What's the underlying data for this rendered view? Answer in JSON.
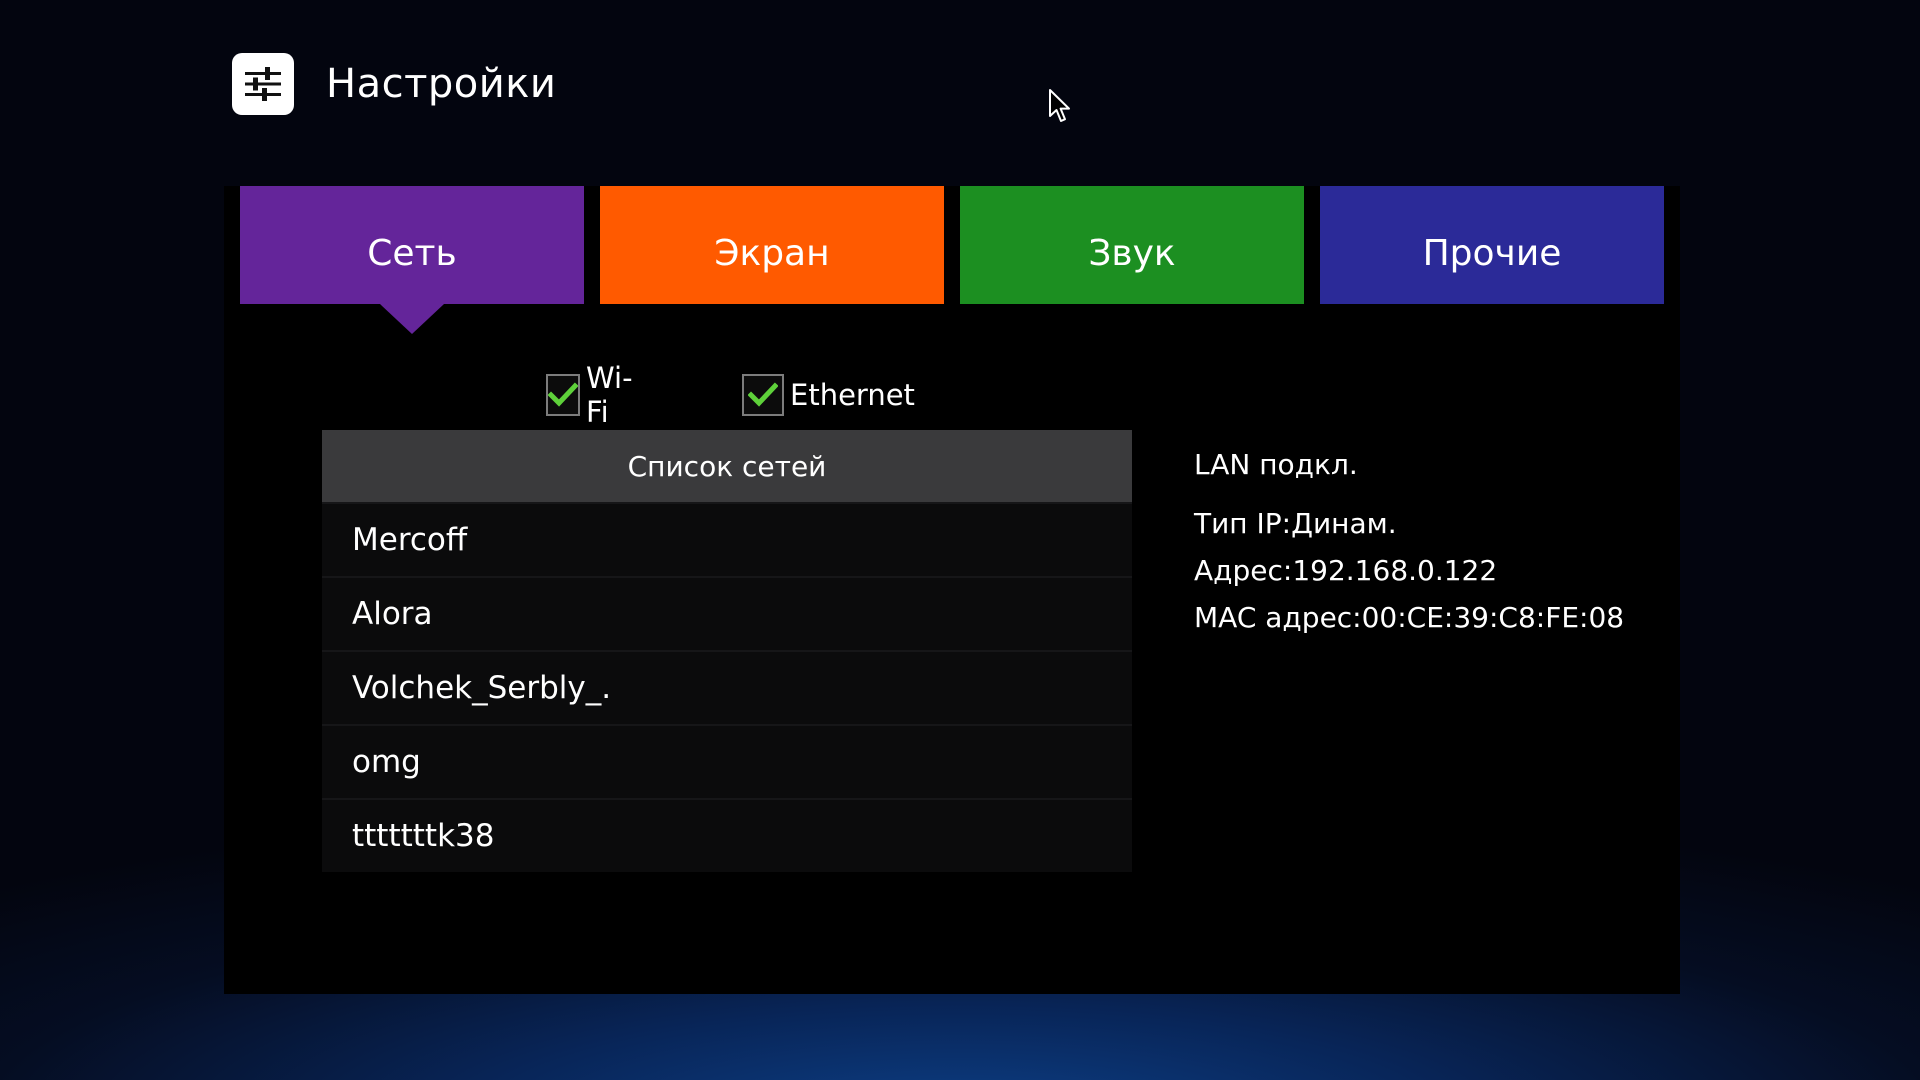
{
  "app": {
    "title": "Настройки",
    "icon": "sliders-icon"
  },
  "tabs": [
    {
      "label": "Сеть",
      "color": "#64259a",
      "active": true
    },
    {
      "label": "Экран",
      "color": "#ff5a00",
      "active": false
    },
    {
      "label": "Звук",
      "color": "#1c8f21",
      "active": false
    },
    {
      "label": "Прочие",
      "color": "#2b2a98",
      "active": false
    }
  ],
  "checkboxes": {
    "wifi": {
      "label": "Wi-Fi",
      "checked": true
    },
    "ethernet": {
      "label": "Ethernet",
      "checked": true
    },
    "check_color": "#5ed13a"
  },
  "network_list": {
    "header": "Список сетей",
    "items": [
      "Mercoff",
      "Alora",
      "Volchek_Serbly_.",
      "omg",
      "tttttttk38"
    ]
  },
  "connection_info": {
    "status": "LAN подкл.",
    "ip_type": "Тип IP:Динам.",
    "address": "Адрес:192.168.0.122",
    "mac": "MAC адрес:00:CE:39:C8:FE:08"
  }
}
